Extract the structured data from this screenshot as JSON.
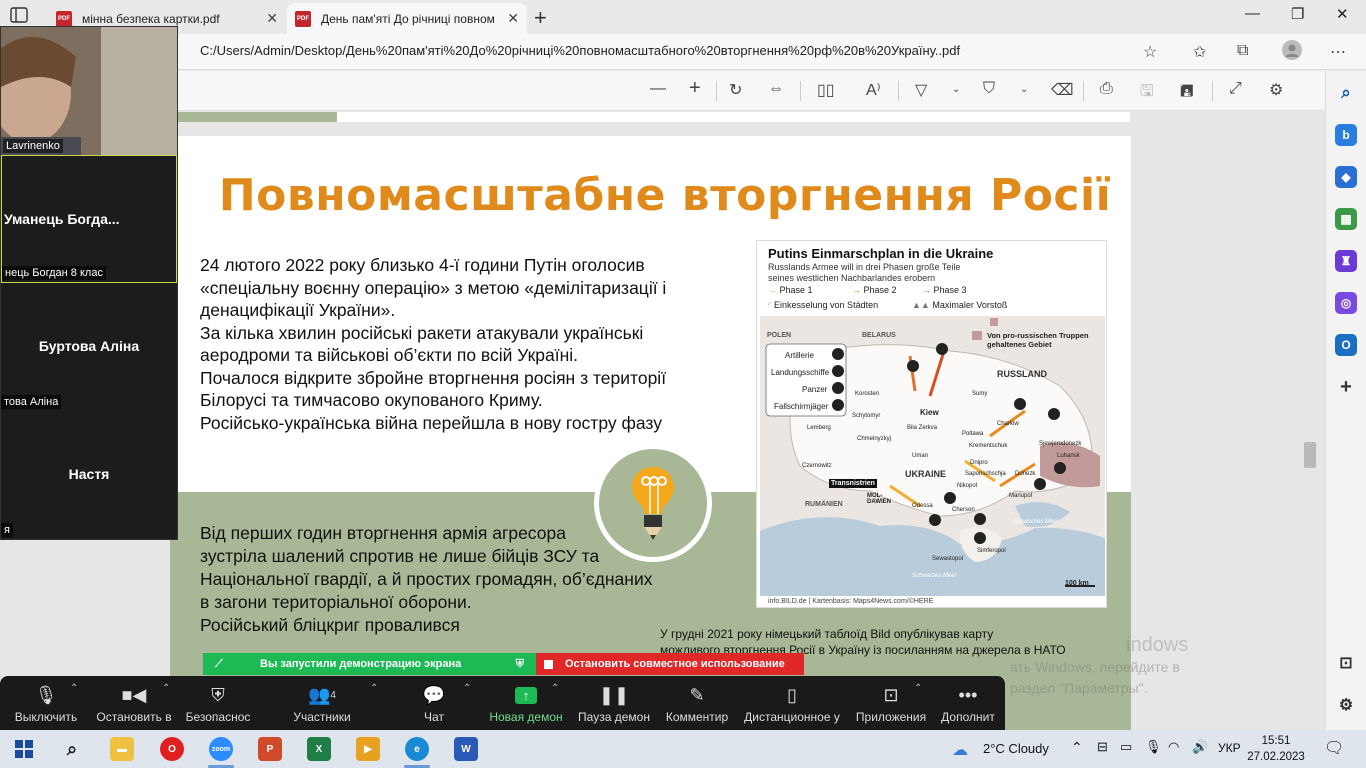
{
  "browser": {
    "tabs": [
      {
        "title": "мінна безпека картки.pdf",
        "icon": "pdf-icon"
      },
      {
        "title": "День пам'яті До річниці повном",
        "icon": "pdf-icon"
      }
    ],
    "address": "C:/Users/Admin/Desktop/День%20пам'яті%20До%20річниці%20повномасштабного%20вторгнення%20рф%20в%20Україну..pdf"
  },
  "slide": {
    "title": "Повномасштабне вторгнення Росії",
    "para1_lines": [
      "24 лютого 2022 року близько 4-ї години Путін оголосив",
      "«спеціальну воєнну операцію» з метою «демілітаризації і",
      "денацифікації України».",
      "За кілька хвилин російські ракети атакували українські",
      "аеродроми та військові об’єкти по всій Україні.",
      "Почалося відкрите збройне вторгнення росіян з території",
      "Білорусі та тимчасово окупованого Криму.",
      "Російсько-українська війна перейшла в нову гостру фазу"
    ],
    "para2_lines": [
      "Від перших годин вторгнення армія агресора",
      "зустріла шалений спротив не лише бійців ЗСУ та",
      "Національної гвардії, а й простих громадян, об’єднаних",
      "в загони територіальної оборони.",
      "Російський бліцкриг провалився"
    ],
    "caption_lines": [
      "У грудні 2021 року німецький таблоїд Bild опублікував карту",
      "можливого вторгнення Росії в Україну із посиланням на джерела в НАТО"
    ],
    "map": {
      "title": "Putins Einmarschplan in die Ukraine",
      "subtitle_lines": [
        "Russlands Armee will in drei Phasen große Teile",
        "seines westlichen Nachbarlandes erobern"
      ],
      "legend": [
        "Phase 1",
        "Phase 2",
        "Phase 3",
        "Einkesselung von Städten",
        "Maximaler Vorstoß"
      ],
      "inset_legend": [
        "Artillerie",
        "Landungsschiffe",
        "Panzer",
        "Fallschirmjäger"
      ],
      "region_note_lines": [
        "Von pro-russischen Truppen",
        "gehaltenes Gebiet"
      ],
      "countries": [
        "POLEN",
        "BELARUS",
        "RUSSLAND",
        "UKRAINE",
        "RUMÄNIEN"
      ],
      "cities": [
        "Kiew",
        "Charkiw",
        "Korosten",
        "Schytomyr",
        "Chmelnyzkyj",
        "Lemberg",
        "Czernowitz",
        "Bila Zerkva",
        "Uman",
        "Sumy",
        "Poltawa",
        "Krementschuk",
        "Dnipro",
        "Saporischschja",
        "Donezk",
        "Luhansk",
        "Sjewjerodonezk",
        "Mariupol",
        "Nikopol",
        "Odessa",
        "Cherson",
        "Simferopol",
        "Sewastopol",
        "Transnistrien",
        "MOL-DAWIEN"
      ],
      "sea_labels": [
        "Asowsches Meer",
        "Schwarzes Meer"
      ],
      "scale": "100 km",
      "credit": "info.BILD.de | Kartenbasis: Maps4News.com/©HERE"
    }
  },
  "zoom": {
    "camera_name": "Lavrinenko",
    "participants": [
      {
        "display": "Уманець  Богда...",
        "label": "нець Богдан 8 клас"
      },
      {
        "display": "Буртова Аліна",
        "label": "това Аліна"
      },
      {
        "display": "Настя",
        "label": "я"
      }
    ],
    "share_banner": {
      "started": "Вы запустили демонстрацию экрана",
      "stop": "Остановить совместное использование"
    },
    "toolbar": [
      {
        "label": "Выключить",
        "icon": "microphone-icon"
      },
      {
        "label": "Остановить в",
        "icon": "video-camera-icon"
      },
      {
        "label": "Безопаснос",
        "icon": "shield-icon"
      },
      {
        "label": "Участники",
        "icon": "participants-icon",
        "count": "4"
      },
      {
        "label": "Чат",
        "icon": "chat-icon"
      },
      {
        "label": "Новая демон",
        "icon": "share-screen-icon"
      },
      {
        "label": "Пауза демон",
        "icon": "pause-icon"
      },
      {
        "label": "Комментир",
        "icon": "pen-icon"
      },
      {
        "label": "Дистанционное у",
        "icon": "mouse-icon"
      },
      {
        "label": "Приложения",
        "icon": "apps-icon"
      },
      {
        "label": "Дополнит",
        "icon": "more-icon"
      }
    ]
  },
  "watermark": {
    "line1": "indows",
    "line2": "ать Windows, перейдите в",
    "line3": "раздел \"Параметры\"."
  },
  "taskbar": {
    "weather": "2°C  Cloudy",
    "language": "УКР",
    "time": "15:51",
    "date": "27.02.2023"
  },
  "colors": {
    "title_orange": "#e08a1c",
    "slide_green": "#a8b896",
    "zoom_green": "#1db955",
    "zoom_red": "#e02828"
  }
}
